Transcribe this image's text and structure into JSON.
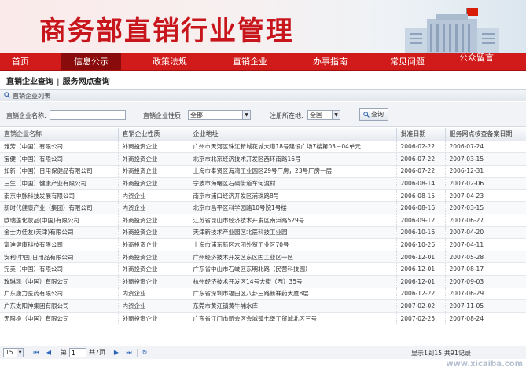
{
  "banner": {
    "title": "商务部直销行业管理"
  },
  "nav": {
    "items": [
      {
        "label": "首页"
      },
      {
        "label": "信息公示"
      },
      {
        "label": "政策法规"
      },
      {
        "label": "直销企业"
      },
      {
        "label": "办事指南"
      },
      {
        "label": "常见问题"
      },
      {
        "label": "公众留言"
      }
    ],
    "active_color": "#8a0b0b",
    "bar_color": "#d11a1a"
  },
  "subtabs": {
    "tab1": "直销企业查询",
    "separator": "|",
    "tab2": "服务网点查询"
  },
  "panel": {
    "title": "直销企业列表"
  },
  "search": {
    "name_label": "直销企业名称:",
    "name_value": "",
    "nature_label": "直销企业性质:",
    "nature_value": "全部",
    "region_label": "注册所在地:",
    "region_value": "全国",
    "query_label": "查询"
  },
  "table": {
    "columns": [
      "直销企业名称",
      "直销企业性质",
      "企业地址",
      "批准日期",
      "服务网点核查备案日期"
    ],
    "rows": [
      [
        "雅芳（中国）有限公司",
        "外商投资企业",
        "广州市天河区珠江新城花城大道18号建设广场7楼第03－04单元",
        "2006-02-22",
        "2006-07-24"
      ],
      [
        "宝健（中国）有限公司",
        "外商投资企业",
        "北京市北京经济技术开发区西环南路16号",
        "2006-07-22",
        "2007-03-15"
      ],
      [
        "如新（中国）日用保健品有限公司",
        "外商投资企业",
        "上海市奉贤区海湾工业园区29号厂房，23号厂房一层",
        "2006-07-22",
        "2006-12-31"
      ],
      [
        "三生（中国）健康产业有限公司",
        "外商投资企业",
        "宁波市海曙区石碶街道车何渡村",
        "2006-08-14",
        "2007-02-06"
      ],
      [
        "南京中脉科技发展有限公司",
        "内资企业",
        "南京市浦口经济开发区浦珠路8号",
        "2006-08-15",
        "2007-04-23"
      ],
      [
        "新时代健康产业（集团）有限公司",
        "内资企业",
        "北京市昌平区科学园路10号院1号楼",
        "2006-08-16",
        "2007-03-15"
      ],
      [
        "欧瑞莲化妆品(中国)有限公司",
        "外商投资企业",
        "江苏省昆山市经济技术开发区南浜路529号",
        "2006-09-12",
        "2007-06-27"
      ],
      [
        "金士力佳友(天津)有限公司",
        "外商投资企业",
        "天津新技术产业园区北辰科技工业园",
        "2006-10-16",
        "2007-04-20"
      ],
      [
        "富迪健康科技有限公司",
        "外商投资企业",
        "上海市浦东新区六团外贸工业区70号",
        "2006-10-26",
        "2007-04-11"
      ],
      [
        "安利(中国)日用品有限公司",
        "外商投资企业",
        "广州经济技术开发区东区国工业区一区",
        "2006-12-01",
        "2007-05-28"
      ],
      [
        "完美（中国）有限公司",
        "外商投资企业",
        "广东省中山市石岐区东明北路（民营科技园）",
        "2006-12-01",
        "2007-08-17"
      ],
      [
        "玫琳凯（中国）有限公司",
        "外商投资企业",
        "杭州经济技术开发区14号大街（西）35号",
        "2006-12-01",
        "2007-09-03"
      ],
      [
        "广东康力医药有限公司",
        "内资企业",
        "广东省深圳市福田区八卦三路新祥药大厦8层",
        "2006-12-22",
        "2007-06-29"
      ],
      [
        "广东太阳神集团有限公司",
        "内资企业",
        "东莞市黄江镇黄牛埔水库",
        "2007-02-02",
        "2007-11-05"
      ],
      [
        "无限极（中国）有限公司",
        "外商投资企业",
        "广东省江门市新会区会城镇七堡工贸城北区三号",
        "2007-02-25",
        "2007-08-24"
      ]
    ]
  },
  "pager": {
    "page_size": "15",
    "page_prefix": "第",
    "page_value": "1",
    "page_suffix": "共7页",
    "info": "显示1到15,共91记录"
  },
  "watermark": "www.xicaiba.com"
}
